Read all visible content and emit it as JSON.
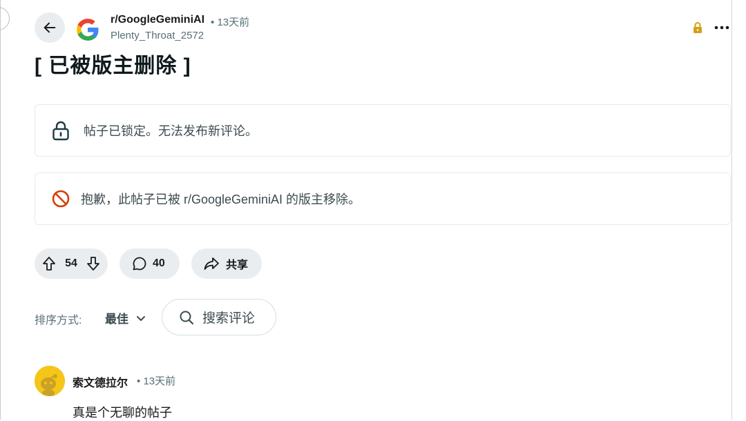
{
  "post": {
    "subreddit": "r/GoogleGeminiAI",
    "separator": "•",
    "time": "13天前",
    "author": "Plenty_Throat_2572",
    "title": "[ 已被版主删除 ]"
  },
  "notices": [
    {
      "icon": "lock-icon",
      "text": "帖子已锁定。无法发布新评论。"
    },
    {
      "icon": "prohibited-icon",
      "text": "抱歉，此帖子已被 r/GoogleGeminiAI 的版主移除。"
    }
  ],
  "actions": {
    "upvotes": "54",
    "comments": "40",
    "share_label": "共享"
  },
  "sort": {
    "label": "排序方式:",
    "value": "最佳"
  },
  "search": {
    "placeholder": "搜索评论"
  },
  "comment": {
    "author": "索文德拉尔",
    "time": "13天前",
    "body": "真是个无聊的帖子"
  },
  "colors": {
    "pill_bg": "#eaedef",
    "border": "#e5ebee",
    "lock_yellow": "#d4a017",
    "prohibited_red": "#d93a00",
    "avatar_yellow": "#f5c518"
  }
}
